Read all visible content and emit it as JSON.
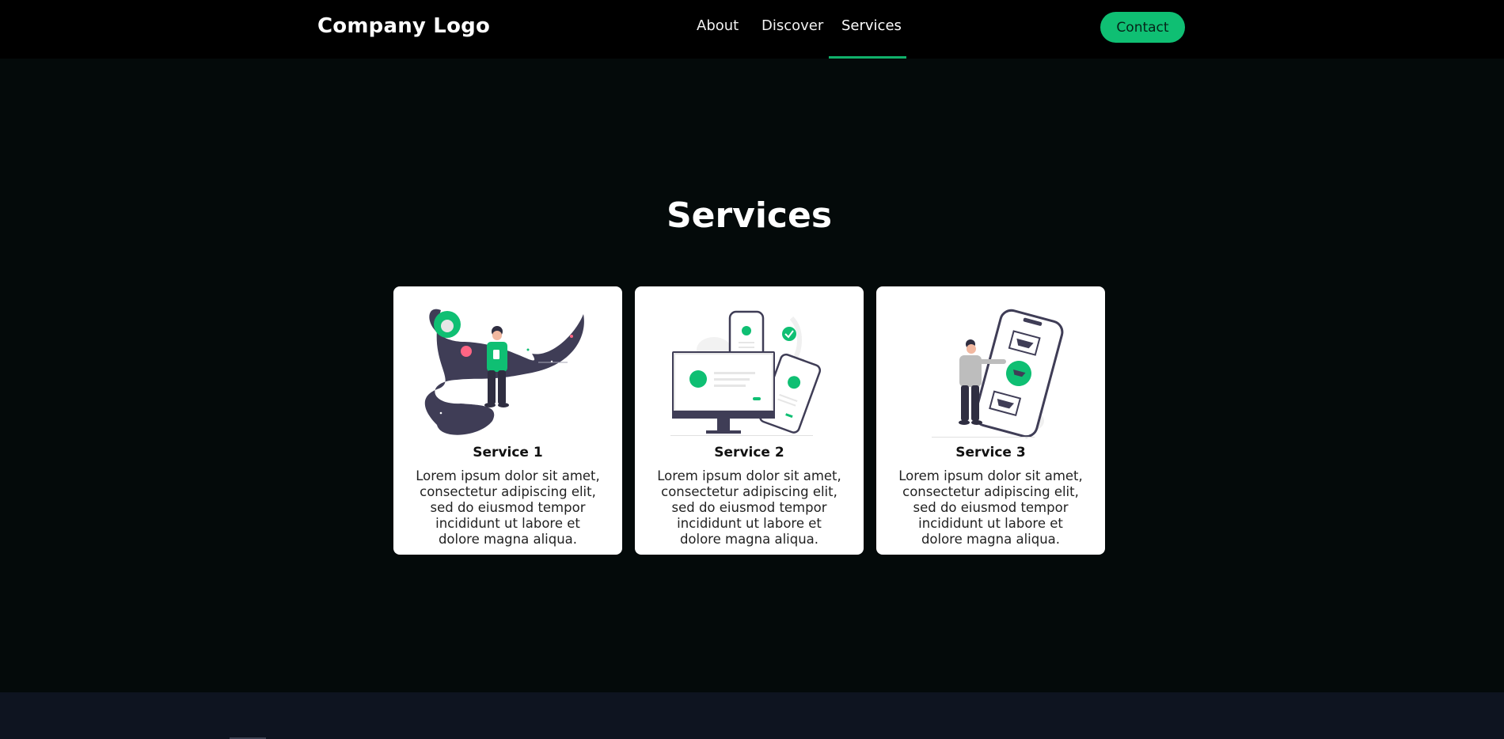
{
  "header": {
    "logo": "Company Logo",
    "nav": [
      {
        "label": "About"
      },
      {
        "label": "Discover"
      },
      {
        "label": "Services",
        "active": true
      }
    ],
    "contact_label": "Contact"
  },
  "main": {
    "title": "Services",
    "cards": [
      {
        "title": "Service 1",
        "text": "Lorem ipsum dolor sit amet, consectetur adipiscing elit, sed do eiusmod tempor incididunt ut labore et dolore magna aliqua."
      },
      {
        "title": "Service 2",
        "text": "Lorem ipsum dolor sit amet, consectetur adipiscing elit, sed do eiusmod tempor incididunt ut labore et dolore magna aliqua."
      },
      {
        "title": "Service 3",
        "text": "Lorem ipsum dolor sit amet, consectetur adipiscing elit, sed do eiusmod tempor incididunt ut labore et dolore magna aliqua."
      }
    ]
  },
  "colors": {
    "accent": "#0fbf73",
    "page_background": "#040a0a",
    "header_background": "#000000",
    "footer_background": "#0e1420",
    "illustration_dark": "#3f3d56"
  },
  "icons": [
    "space-person-illustration",
    "devices-checkmark-illustration",
    "person-phone-illustration"
  ]
}
